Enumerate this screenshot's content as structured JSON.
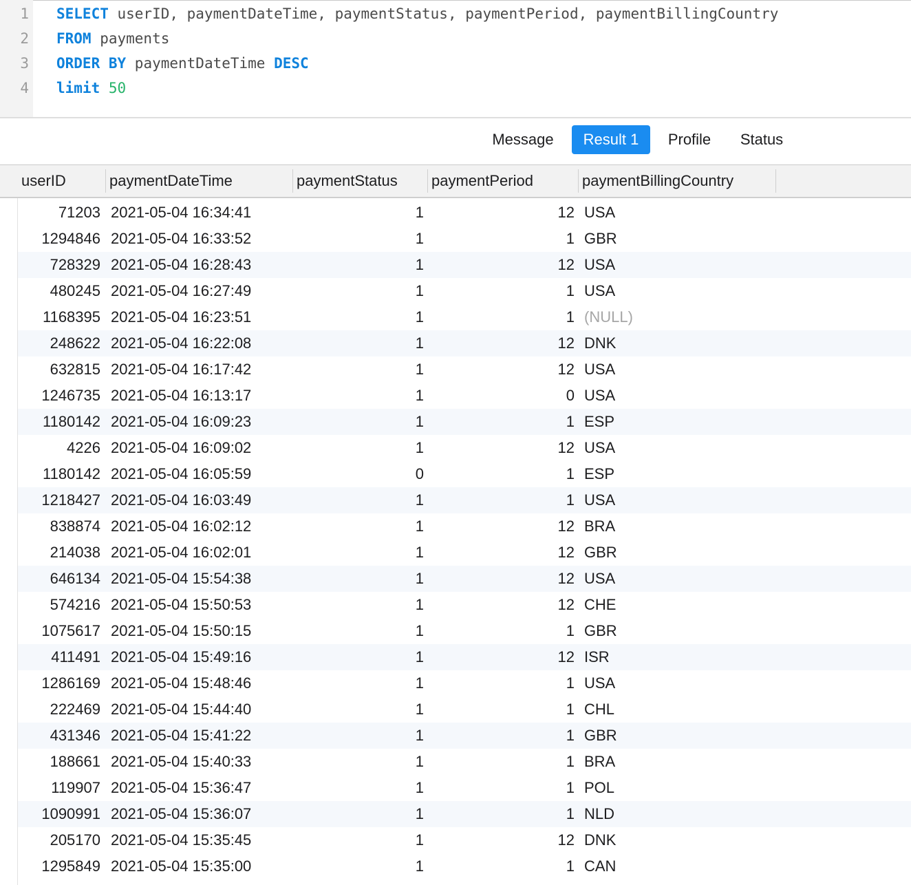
{
  "editor": {
    "line_numbers": [
      "1",
      "2",
      "3",
      "4"
    ],
    "lines": [
      [
        {
          "t": "SELECT",
          "c": "kw"
        },
        {
          "t": " userID, paymentDateTime, paymentStatus, paymentPeriod, paymentBillingCountry",
          "c": ""
        }
      ],
      [
        {
          "t": "FROM",
          "c": "kw"
        },
        {
          "t": " payments",
          "c": ""
        }
      ],
      [
        {
          "t": "ORDER BY",
          "c": "kw"
        },
        {
          "t": " paymentDateTime ",
          "c": ""
        },
        {
          "t": "DESC",
          "c": "kw"
        }
      ],
      [
        {
          "t": "limit",
          "c": "kw"
        },
        {
          "t": " ",
          "c": ""
        },
        {
          "t": "50",
          "c": "num"
        }
      ]
    ]
  },
  "tabs": [
    {
      "label": "Message",
      "active": false
    },
    {
      "label": "Result 1",
      "active": true
    },
    {
      "label": "Profile",
      "active": false
    },
    {
      "label": "Status",
      "active": false
    }
  ],
  "grid": {
    "columns": [
      "userID",
      "paymentDateTime",
      "paymentStatus",
      "paymentPeriod",
      "paymentBillingCountry"
    ],
    "rows": [
      [
        "71203",
        "2021-05-04 16:34:41",
        "1",
        "12",
        "USA"
      ],
      [
        "1294846",
        "2021-05-04 16:33:52",
        "1",
        "1",
        "GBR"
      ],
      [
        "728329",
        "2021-05-04 16:28:43",
        "1",
        "12",
        "USA"
      ],
      [
        "480245",
        "2021-05-04 16:27:49",
        "1",
        "1",
        "USA"
      ],
      [
        "1168395",
        "2021-05-04 16:23:51",
        "1",
        "1",
        "(NULL)"
      ],
      [
        "248622",
        "2021-05-04 16:22:08",
        "1",
        "12",
        "DNK"
      ],
      [
        "632815",
        "2021-05-04 16:17:42",
        "1",
        "12",
        "USA"
      ],
      [
        "1246735",
        "2021-05-04 16:13:17",
        "1",
        "0",
        "USA"
      ],
      [
        "1180142",
        "2021-05-04 16:09:23",
        "1",
        "1",
        "ESP"
      ],
      [
        "4226",
        "2021-05-04 16:09:02",
        "1",
        "12",
        "USA"
      ],
      [
        "1180142",
        "2021-05-04 16:05:59",
        "0",
        "1",
        "ESP"
      ],
      [
        "1218427",
        "2021-05-04 16:03:49",
        "1",
        "1",
        "USA"
      ],
      [
        "838874",
        "2021-05-04 16:02:12",
        "1",
        "12",
        "BRA"
      ],
      [
        "214038",
        "2021-05-04 16:02:01",
        "1",
        "12",
        "GBR"
      ],
      [
        "646134",
        "2021-05-04 15:54:38",
        "1",
        "12",
        "USA"
      ],
      [
        "574216",
        "2021-05-04 15:50:53",
        "1",
        "12",
        "CHE"
      ],
      [
        "1075617",
        "2021-05-04 15:50:15",
        "1",
        "1",
        "GBR"
      ],
      [
        "411491",
        "2021-05-04 15:49:16",
        "1",
        "12",
        "ISR"
      ],
      [
        "1286169",
        "2021-05-04 15:48:46",
        "1",
        "1",
        "USA"
      ],
      [
        "222469",
        "2021-05-04 15:44:40",
        "1",
        "1",
        "CHL"
      ],
      [
        "431346",
        "2021-05-04 15:41:22",
        "1",
        "1",
        "GBR"
      ],
      [
        "188661",
        "2021-05-04 15:40:33",
        "1",
        "1",
        "BRA"
      ],
      [
        "119907",
        "2021-05-04 15:36:47",
        "1",
        "1",
        "POL"
      ],
      [
        "1090991",
        "2021-05-04 15:36:07",
        "1",
        "1",
        "NLD"
      ],
      [
        "205170",
        "2021-05-04 15:35:45",
        "1",
        "12",
        "DNK"
      ],
      [
        "1295849",
        "2021-05-04 15:35:00",
        "1",
        "1",
        "CAN"
      ]
    ]
  }
}
